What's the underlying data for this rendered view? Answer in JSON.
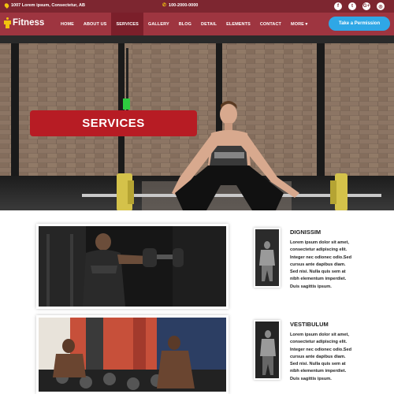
{
  "topbar": {
    "address": "1007 Lorem ipsum, Consectetur, AB",
    "phone": "100-2000-0000",
    "socials": [
      "f",
      "t",
      "G+",
      "◎"
    ]
  },
  "nav": {
    "logo": "Fitness",
    "items": [
      {
        "label": "HOME"
      },
      {
        "label": "ABOUT US"
      },
      {
        "label": "SERVICES"
      },
      {
        "label": "GALLERY"
      },
      {
        "label": "BLOG"
      },
      {
        "label": "DETAIL"
      },
      {
        "label": "ELEMENTS"
      },
      {
        "label": "CONTACT"
      },
      {
        "label": "MORE ▾"
      }
    ],
    "active_index": 2,
    "cta": "Take a Permission"
  },
  "hero": {
    "title": "SERVICES"
  },
  "services": [
    {
      "title": "DIGNISSIM",
      "text": "Lorem ipsum dolor sit amet, consectetur adipiscing elit. Integer nec odionec odio.Sed cursus ante dapibus diam. Sed nisi. Nulla quis sem at nibh elementum imperdiet. Duis sagittis ipsum."
    },
    {
      "title": "VESTIBULUM",
      "text": "Lorem ipsum dolor sit amet, consectetur adipiscing elit. Integer nec odionec odio.Sed cursus ante dapibus diam. Sed nisi. Nulla quis sem at nibh elementum imperdiet. Duis sagittis ipsum."
    }
  ],
  "colors": {
    "topbar": "#7d2630",
    "nav": "#9e3540",
    "nav_active": "#7b1f2a",
    "accent_red": "#b71c24",
    "cta_blue": "#2fa7e6",
    "icon_yellow": "#f1c40f"
  }
}
